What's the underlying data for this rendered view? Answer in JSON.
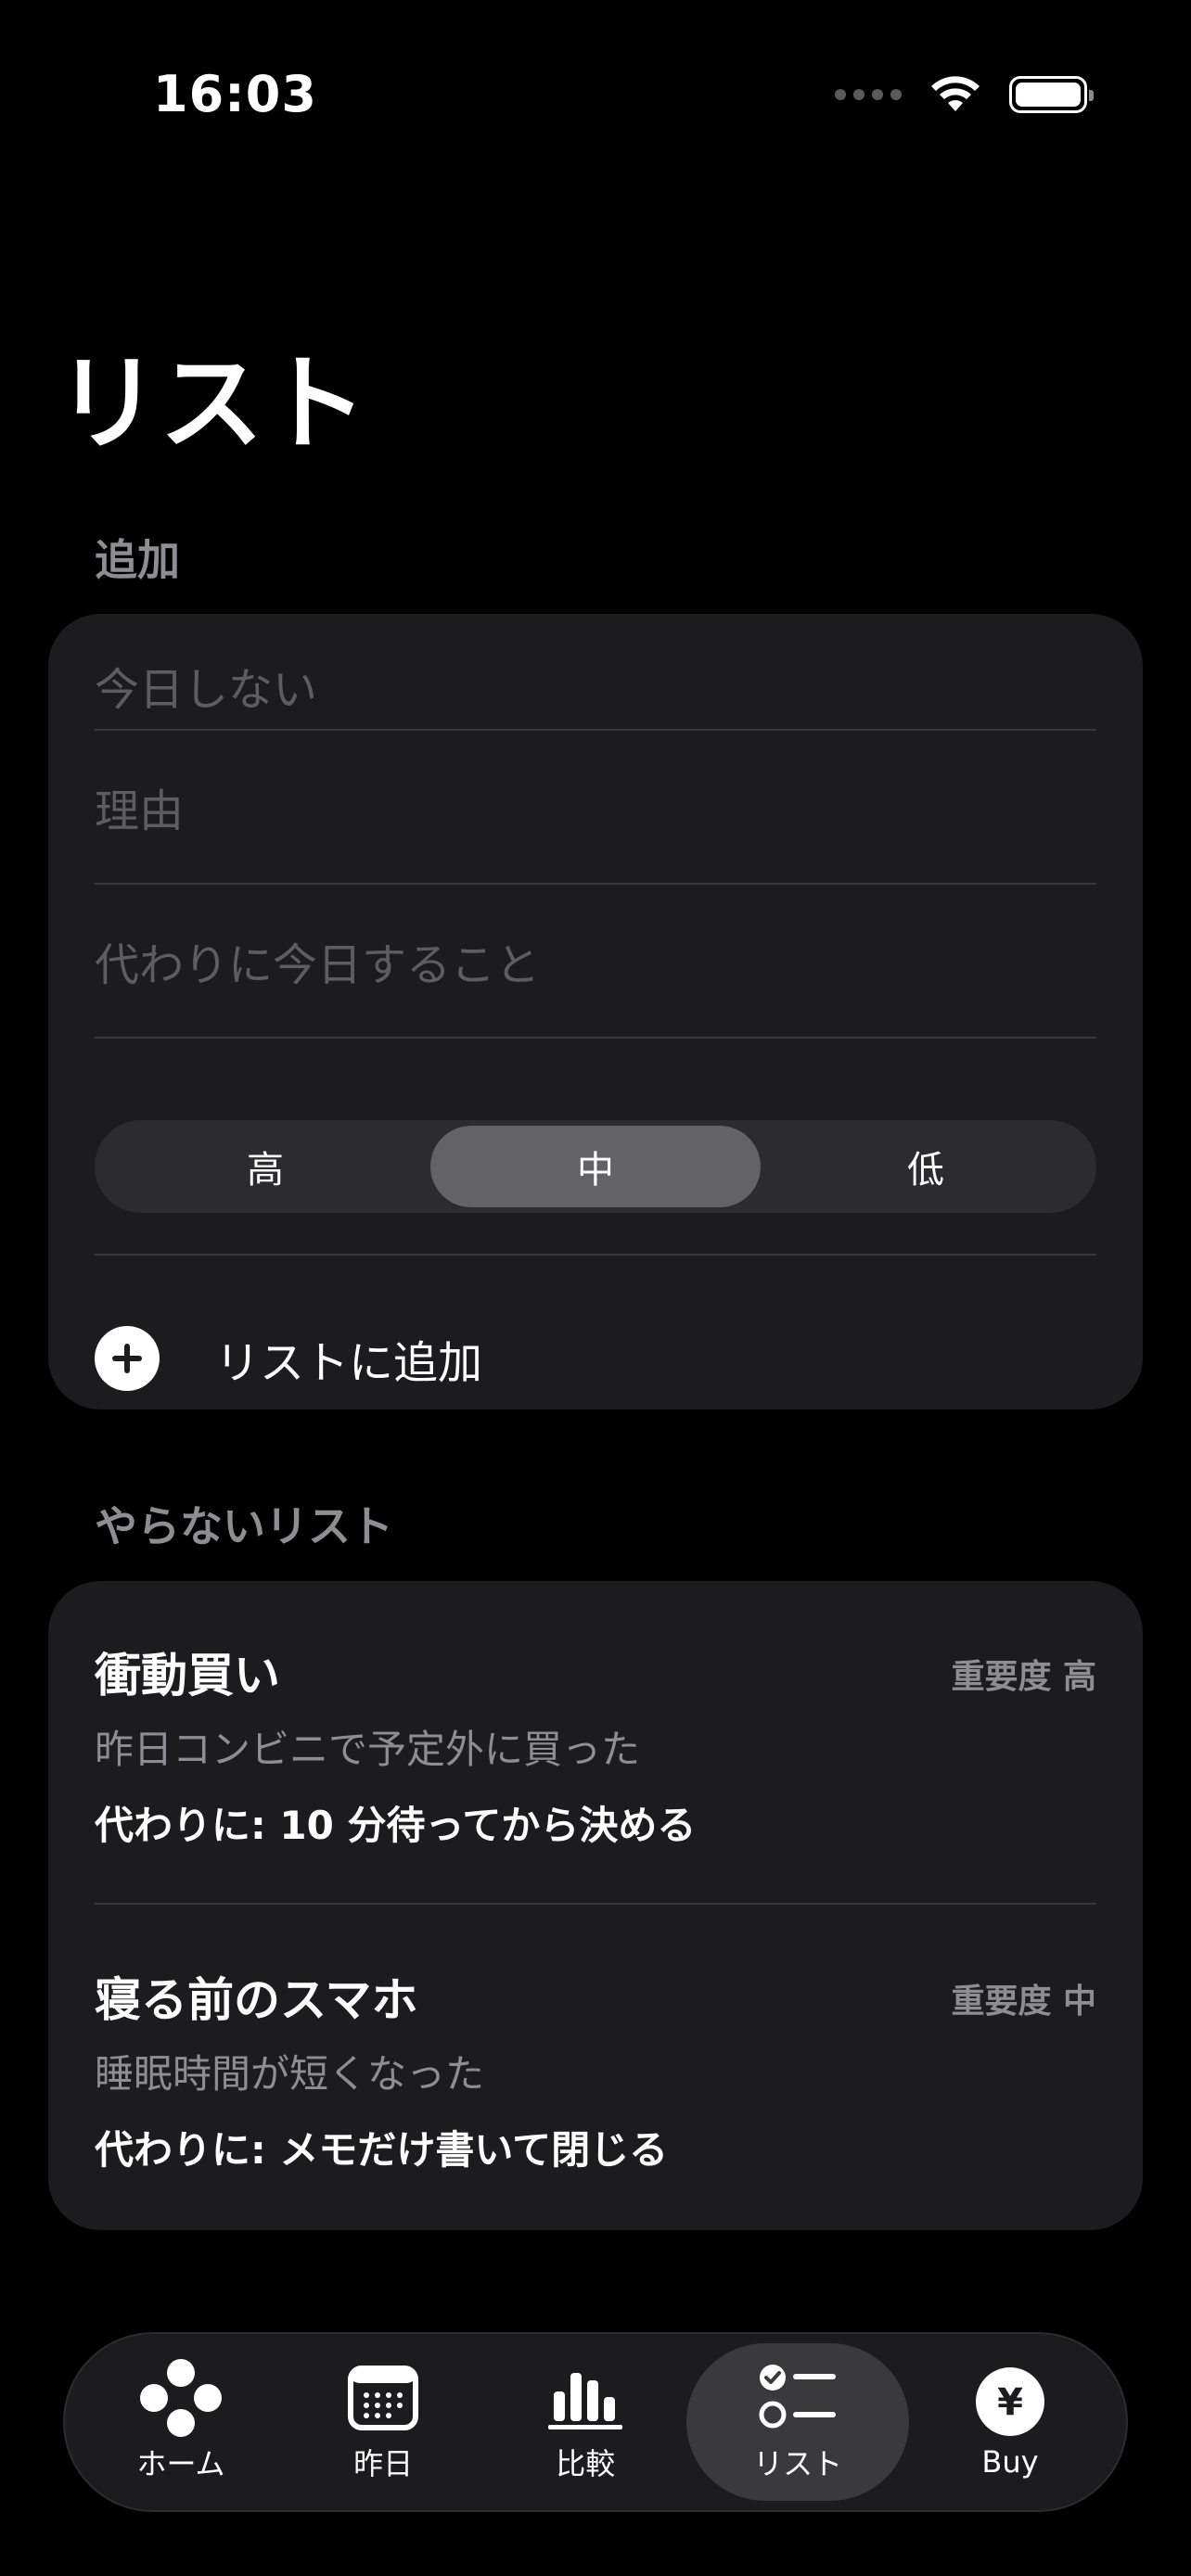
{
  "status_bar": {
    "time": "16:03"
  },
  "title": "リスト",
  "add_section": {
    "header": "追加",
    "fields": [
      {
        "placeholder": "今日しない"
      },
      {
        "placeholder": "理由"
      },
      {
        "placeholder": "代わりに今日すること"
      }
    ],
    "priority_options": [
      "高",
      "中",
      "低"
    ],
    "priority_selected": "中",
    "add_button_label": "リストに追加"
  },
  "list_section": {
    "header": "やらないリスト",
    "items": [
      {
        "title": "衝動買い",
        "priority": "重要度 高",
        "reason": "昨日コンビニで予定外に買った",
        "alternative": "代わりに: 10 分待ってから決める"
      },
      {
        "title": "寝る前のスマホ",
        "priority": "重要度 中",
        "reason": "睡眠時間が短くなった",
        "alternative": "代わりに: メモだけ書いて閉じる"
      }
    ]
  },
  "tab_bar": {
    "active": "リスト",
    "tabs": [
      {
        "label": "ホーム",
        "icon": "home-dots-icon"
      },
      {
        "label": "昨日",
        "icon": "calendar-icon"
      },
      {
        "label": "比較",
        "icon": "bar-chart-icon"
      },
      {
        "label": "リスト",
        "icon": "checklist-icon"
      },
      {
        "label": "Buy",
        "icon": "yen-icon"
      }
    ]
  }
}
